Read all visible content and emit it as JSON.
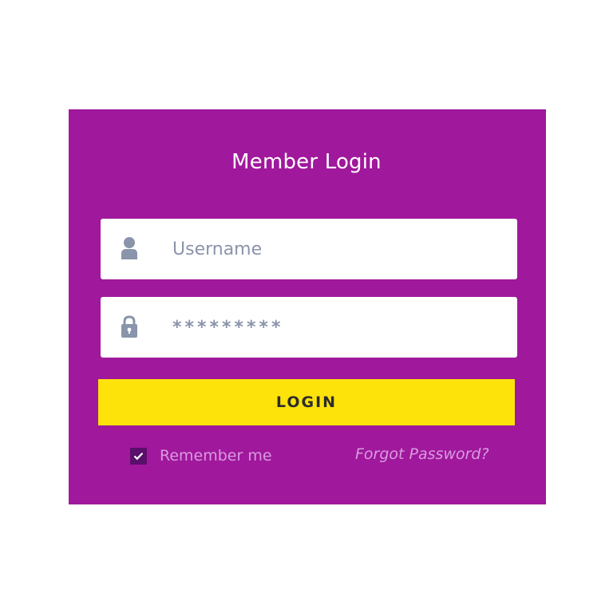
{
  "login_card": {
    "title": "Member Login",
    "username": {
      "placeholder": "Username",
      "value": "",
      "icon": "user-icon"
    },
    "password": {
      "placeholder": "",
      "value": "*********",
      "icon": "lock-icon"
    },
    "login_button_label": "LOGIN",
    "remember_me": {
      "label": "Remember me",
      "checked": true
    },
    "forgot_password_label": "Forgot Password?"
  },
  "colors": {
    "card_background": "#a0189c",
    "button_background": "#fde30a",
    "button_text": "#2c2c2c",
    "field_background": "#ffffff",
    "field_text": "#8a94aa",
    "checkbox_background": "#5a0f6b",
    "secondary_text": "#d99be0"
  }
}
